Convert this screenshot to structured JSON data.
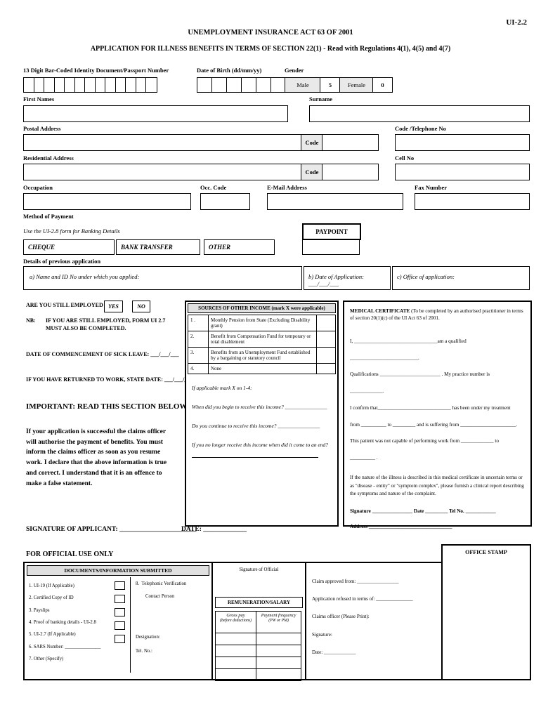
{
  "form_code": "UI-2.2",
  "titles": {
    "line1": "UNEMPLOYMENT INSURANCE ACT 63 OF 2001",
    "line2": "APPLICATION FOR ILLNESS BENEFITS IN TERMS OF SECTION 22(1) - Read with Regulations 4(1), 4(5) and 4(7)"
  },
  "personal": {
    "id_label": "13 Digit Bar-Coded Identity Document/Passport Number",
    "dob_label": "Date of Birth (dd/mm/yy)",
    "gender_label": "Gender",
    "male_label": "Male",
    "male_value": "5",
    "female_label": "Female",
    "female_value": "0",
    "first_names_label": "First Names",
    "surname_label": "Surname",
    "postal_label": "Postal Address",
    "code_label": "Code",
    "code_tel_label": "Code /Telephone No",
    "residential_label": "Residential Address",
    "cell_label": "Cell No",
    "occupation_label": "Occupation",
    "occ_code_label": "Occ. Code",
    "email_label": "E-Mail Address",
    "fax_label": "Fax Number"
  },
  "payment": {
    "method_label": "Method of Payment",
    "banking_note": "Use the UI-2.8 form for Banking Details",
    "cheque": "CHEQUE",
    "bank_transfer": "BANK TRANSFER",
    "other": "OTHER",
    "paypoint": "PAYPOINT"
  },
  "previous": {
    "heading": "Details of previous application",
    "a": "a)    Name and ID No under which you applied:",
    "b": "b)    Date of Application:   ___/___/___",
    "c": "c)    Office of application:"
  },
  "employment": {
    "still_employed": "ARE YOU STILL EMPLOYED",
    "yes": "YES",
    "no": "NO",
    "nb": "NB:",
    "nb_text": "IF YOU ARE STILL EMPLOYED, FORM UI 2.7 MUST ALSO BE COMPLETED.",
    "sick_leave": "DATE OF COMMENCEMENT OF SICK LEAVE:     ___/___/___",
    "returned": "IF YOU HAVE RETURNED TO WORK, STATE DATE: ___/___/___",
    "important_heading": "IMPORTANT: READ THIS SECTION BELOW:",
    "important_text": "If your application is successful the claims officer will authorise the payment of benefits. You must inform the claims officer as soon as you resume work. I declare that the above information is true and correct.  I understand that it is an offence to make a false statement."
  },
  "income": {
    "header": "SOURCES OF OTHER INCOME (mark X were applicable)",
    "rows": [
      {
        "n": "1 .",
        "text": "Monthly Pension from State (Excluding Disability grant)"
      },
      {
        "n": "2.",
        "text": "Benefit from Compensation Fund for temporary or total disablement"
      },
      {
        "n": "3.",
        "text": "Benefits from an Unemployment Fund established by a bargaining or statutory council"
      },
      {
        "n": "4.",
        "text": "None"
      }
    ],
    "q0": "If applicable mark X on 1-4:",
    "q1": "When did you begin to receive this income? ________________",
    "q2": "Do you continue to receive this income? ________________",
    "q3": "If you no longer receive this income when did it come to an end?"
  },
  "medical": {
    "heading": "MEDICAL CERTIFICATE",
    "heading_rest": "(To be completed by an authorised practitioner in terms of section 20(1)(c) of the UI Act 63 of 2001.",
    "l1": "I, _________________________________am a qualified ___________________________.",
    "l2": "Qualifications ________________________ . My practice number is _____________.",
    "l3": "I confirm that_____________________________ has been under my treatment",
    "l4": "from __________ to _________ and is suffering from ______________________.",
    "l5": "This patient was not capable of performing work from _____________  to __________ .",
    "l6": "If the nature of the illness is described in this medical certificate in uncertain terms or as \"disease - entity\" or \"symptom complex\", please furnish a clinical report describing the symptoms and nature of the complaint.",
    "sig": "Signature ________________   Date _________   Tel No. ____________",
    "addr": "Address _________________________________"
  },
  "signature": {
    "applicant": "SIGNATURE OF APPLICANT: _______________________",
    "date": "DATE: _____________"
  },
  "official": {
    "heading": "FOR OFFICIAL USE ONLY",
    "stamp": "OFFICE STAMP",
    "docs_heading": "DOCUMENTS/INFORMATION SUBMITTED",
    "docs": [
      {
        "n": "1.",
        "text": "UI-19 (If Applicable)"
      },
      {
        "n": "2.",
        "text": "Certified Copy of ID"
      },
      {
        "n": "3.",
        "text": "Payslips"
      },
      {
        "n": "4.",
        "text": "Proof of banking details - UI-2.8"
      },
      {
        "n": "5.",
        "text": "UI-2.7 (If Applicable)"
      },
      {
        "n": "6.",
        "text": "SARS Number: _______________"
      },
      {
        "n": "7.",
        "text": "Other (Specify)"
      }
    ],
    "doc8_n": "8.",
    "doc8_text": "Telephonic Verification",
    "contact_person": "Contact Person",
    "designation": "Designation:",
    "tel_no": "Tel. No.:",
    "sig_official": "Signature of Official",
    "remuneration": "REMUNERATION/SALARY",
    "rem_col1": "Gross pay",
    "rem_col1_sub": "(before deductions)",
    "rem_col2": "Payment frequency",
    "rem_col2_sub": "(PW or PM)",
    "approved": "Claim approved from: _________________",
    "refused": "Application refused in terms of: _______________",
    "claims_officer": "Claims officer (Please Print):",
    "sig": "Signature:",
    "date": "Date: _____________"
  }
}
